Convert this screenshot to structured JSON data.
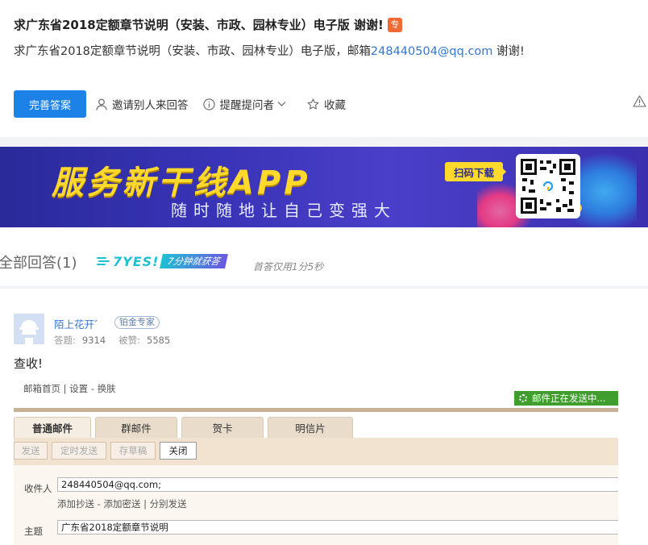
{
  "question": {
    "title": "求广东省2018定额章节说明（安装、市政、园林专业）电子版 谢谢!",
    "badge": "专",
    "desc_before": "求广东省2018定额章节说明（安装、市政、园林专业）电子版，邮箱",
    "desc_email": "248440504@qq.com",
    "desc_after": " 谢谢!"
  },
  "actions": {
    "complete_answer": "完善答案",
    "invite": "邀请别人来回答",
    "remind": "提醒提问者",
    "favorite": "收藏"
  },
  "banner": {
    "headline": "服务新干线APP",
    "subline": "随时随地让自己变强大",
    "scan_label": "扫码下载"
  },
  "answers": {
    "count_label": "全部回答(1)",
    "yes_label": "7YES!",
    "fast_label": "7分钟就获答",
    "first_answer": "首答仅用1分5秒"
  },
  "answer": {
    "username": "陌上花开゛",
    "level": "铂金专家",
    "answers_label": "答题:",
    "answers_count": "9314",
    "accepted_label": "被赞:",
    "accepted_count": "5585",
    "text": "查收!"
  },
  "mail_screenshot": {
    "toplinks": "邮箱首页 | 设置 - 换肤",
    "sending": "邮件正在发送中...",
    "tabs": [
      "普通邮件",
      "群邮件",
      "贺卡",
      "明信片"
    ],
    "toolbar": [
      "发送",
      "定时发送",
      "存草稿",
      "关闭"
    ],
    "to_label": "收件人",
    "to_value": "248440504@qq.com;",
    "cc_links": "添加抄送 - 添加密送 | 分别发送",
    "subject_label": "主题",
    "subject_value": "广东省2018定额章节说明"
  },
  "colors": {
    "primary": "#1c82e8",
    "link": "#3476d2",
    "banner_yellow": "#ffd92c",
    "badge_orange": "#f06a35",
    "sending_green": "#3f9e2e"
  }
}
